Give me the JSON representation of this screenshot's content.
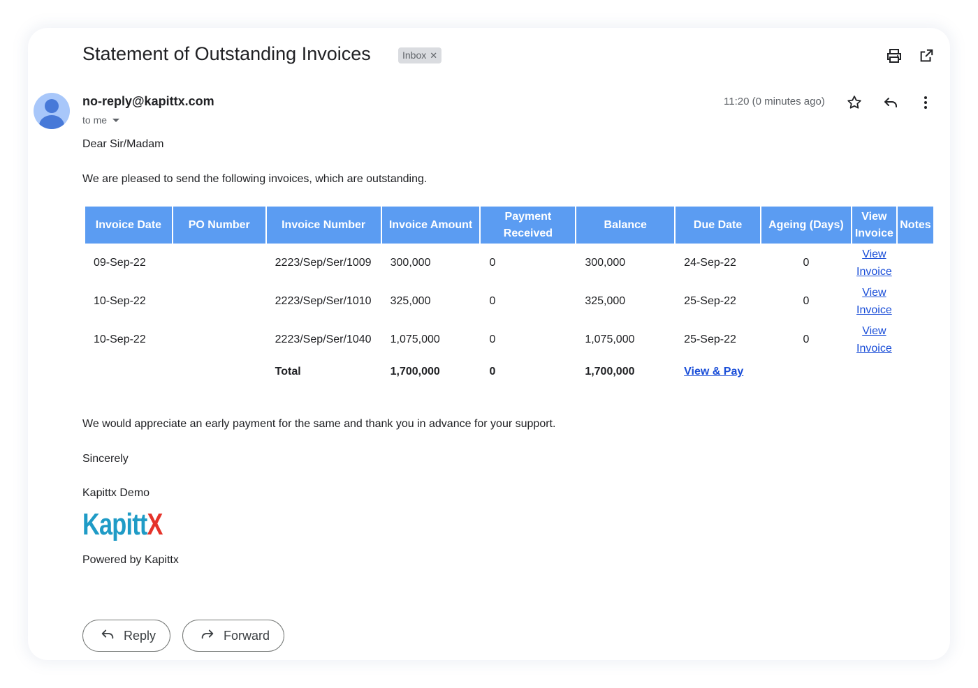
{
  "email": {
    "subject": "Statement of Outstanding Invoices",
    "label_badge": "Inbox",
    "sender": "no-reply@kapittx.com",
    "recipient": "to me",
    "timestamp": "11:20 (0 minutes ago)"
  },
  "icons": {
    "print": "print-icon",
    "open_new_window": "open-in-new-icon",
    "star": "star-icon",
    "reply": "reply-icon",
    "more": "more-vert-icon",
    "forward": "forward-icon"
  },
  "body": {
    "greeting": "Dear Sir/Madam",
    "intro": "We are pleased to send the following invoices, which are outstanding.",
    "closing_note": "We would appreciate an early payment for the same and thank you in advance for your support.",
    "signoff": "Sincerely",
    "signature": "Kapittx Demo",
    "logo_text_main": "Kapitt",
    "logo_text_accent": "X",
    "powered_by": "Powered by Kapittx"
  },
  "table": {
    "headers": {
      "invoice_date": "Invoice Date",
      "po_number": "PO Number",
      "invoice_number": "Invoice Number",
      "invoice_amount": "Invoice Amount",
      "payment_received_1": "Payment",
      "payment_received_2": "Received",
      "balance": "Balance",
      "due_date": "Due Date",
      "ageing": "Ageing (Days)",
      "view_invoice_1": "View",
      "view_invoice_2": "Invoice",
      "notes": "Notes"
    },
    "rows": [
      {
        "invoice_date": "09-Sep-22",
        "po_number": "",
        "invoice_number": "2223/Sep/Ser/1009",
        "invoice_amount": "300,000",
        "payment_received": "0",
        "balance": "300,000",
        "due_date": "24-Sep-22",
        "ageing": "0",
        "view_1": "View",
        "view_2": "Invoice",
        "notes": ""
      },
      {
        "invoice_date": "10-Sep-22",
        "po_number": "",
        "invoice_number": "2223/Sep/Ser/1010",
        "invoice_amount": "325,000",
        "payment_received": "0",
        "balance": "325,000",
        "due_date": "25-Sep-22",
        "ageing": "0",
        "view_1": "View",
        "view_2": "Invoice",
        "notes": ""
      },
      {
        "invoice_date": "10-Sep-22",
        "po_number": "",
        "invoice_number": "2223/Sep/Ser/1040",
        "invoice_amount": "1,075,000",
        "payment_received": "0",
        "balance": "1,075,000",
        "due_date": "25-Sep-22",
        "ageing": "0",
        "view_1": "View",
        "view_2": "Invoice",
        "notes": ""
      }
    ],
    "total": {
      "label": "Total",
      "invoice_amount": "1,700,000",
      "payment_received": "0",
      "balance": "1,700,000",
      "pay_link": "View & Pay"
    }
  },
  "actions": {
    "reply": "Reply",
    "forward": "Forward"
  },
  "colors": {
    "header_blue": "#5b9cf2",
    "link_blue": "#1a4ed8",
    "avatar_bg": "#a8c7fa",
    "logo_teal": "#1f9bc6",
    "logo_red": "#e5332a"
  }
}
